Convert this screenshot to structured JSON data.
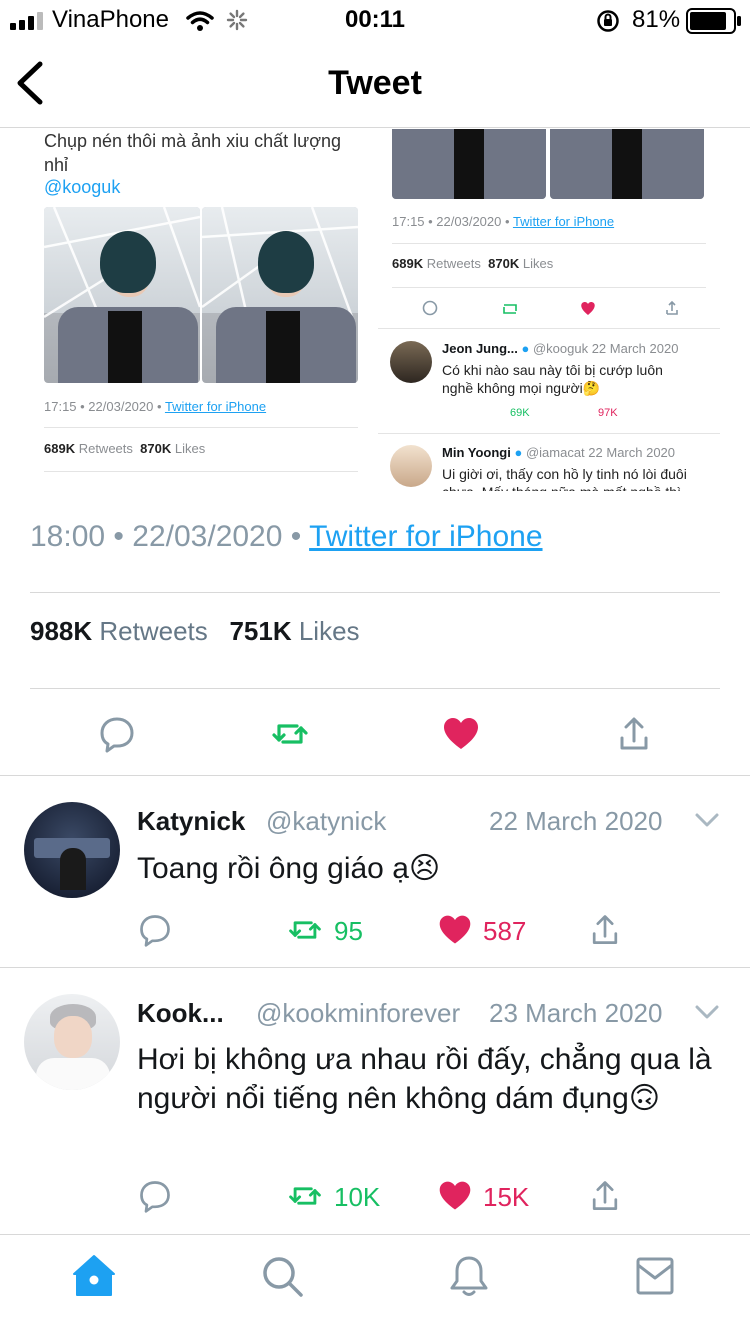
{
  "status_bar": {
    "carrier": "VinaPhone",
    "time": "00:11",
    "battery": "81%"
  },
  "header": {
    "title": "Tweet"
  },
  "embedded_screenshot": {
    "left": {
      "caption": "Chụp nén thôi mà ảnh xiu chất lượng nhỉ",
      "mention": "@kooguk",
      "timestamp": "17:15 • 22/03/2020 •",
      "source": "Twitter for iPhone",
      "retweets": "689K",
      "retweets_label": "Retweets",
      "likes": "870K",
      "likes_label": "Likes"
    },
    "right": {
      "timestamp": "17:15 • 22/03/2020 •",
      "source": "Twitter for iPhone",
      "retweets": "689K",
      "retweets_label": "Retweets",
      "likes": "870K",
      "likes_label": "Likes",
      "replies": [
        {
          "name": "Jeon Jung...",
          "handle": "@kooguk",
          "date": "22 March 2020",
          "text": "Có khi nào sau này tôi bị cướp luôn nghề không mọi người🤔",
          "retweets": "69K",
          "likes": "97K"
        },
        {
          "name": "Min Yoongi",
          "handle": "@iamacat",
          "date": "22 March 2020",
          "text": "Ui giời ơi, thấy con hồ ly tinh nó lòi đuôi chưa. Mấy tháng nữa mà mất nghề thì"
        }
      ]
    }
  },
  "tweet_meta": {
    "time": "18:00",
    "date": "22/03/2020",
    "separator": "•",
    "source": "Twitter for iPhone",
    "retweets": "988K",
    "retweets_label": "Retweets",
    "likes": "751K",
    "likes_label": "Likes"
  },
  "replies": [
    {
      "name": "Katynick",
      "handle": "@katynick",
      "date": "22 March 2020",
      "text": "Toang rồi ông giáo ạ😣",
      "retweets": "95",
      "likes": "587"
    },
    {
      "name": "Kook...",
      "handle": "@kookminforever",
      "date": "23 March 2020",
      "text": "Hơi bị không ưa nhau rồi đấy, chẳng qua là người nổi tiếng nên không dám đụng🙃",
      "retweets": "10K",
      "likes": "15K"
    }
  ],
  "colors": {
    "accent": "#1da1f2",
    "retweet": "#17bf63",
    "like": "#e0245e",
    "icon_gray": "#8899a6"
  },
  "icons": [
    "back-chevron-icon",
    "reply-icon",
    "retweet-icon",
    "like-icon",
    "share-icon",
    "home-icon",
    "search-icon",
    "bell-icon",
    "mail-icon"
  ]
}
